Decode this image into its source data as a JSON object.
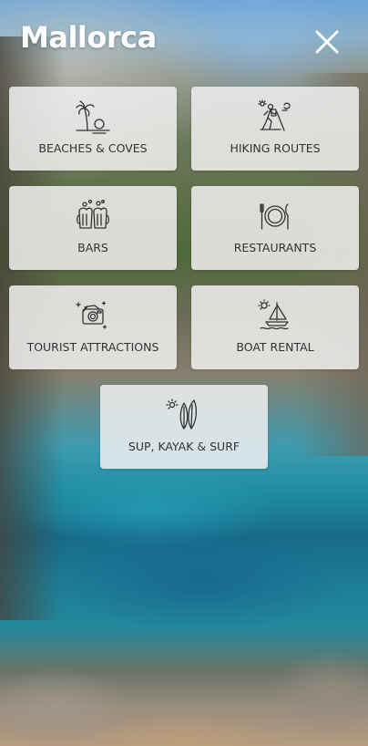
{
  "header": {
    "title": "Mallorca",
    "close_icon": "close-icon"
  },
  "categories": [
    {
      "label": "BEACHES & COVES",
      "icon": "palm-beach-icon"
    },
    {
      "label": "HIKING ROUTES",
      "icon": "hiker-icon"
    },
    {
      "label": "BARS",
      "icon": "beer-mugs-icon"
    },
    {
      "label": "RESTAURANTS",
      "icon": "plate-cutlery-icon"
    },
    {
      "label": "TOURIST ATTRACTIONS",
      "icon": "camera-icon"
    },
    {
      "label": "BOAT RENTAL",
      "icon": "sailboat-icon"
    },
    {
      "label": "SUP, KAYAK & SURF",
      "icon": "surfboards-icon"
    }
  ],
  "colors": {
    "tile_bg": "#f0f0f0",
    "text": "#333333",
    "icon_stroke": "#333333",
    "title": "#ffffff"
  }
}
